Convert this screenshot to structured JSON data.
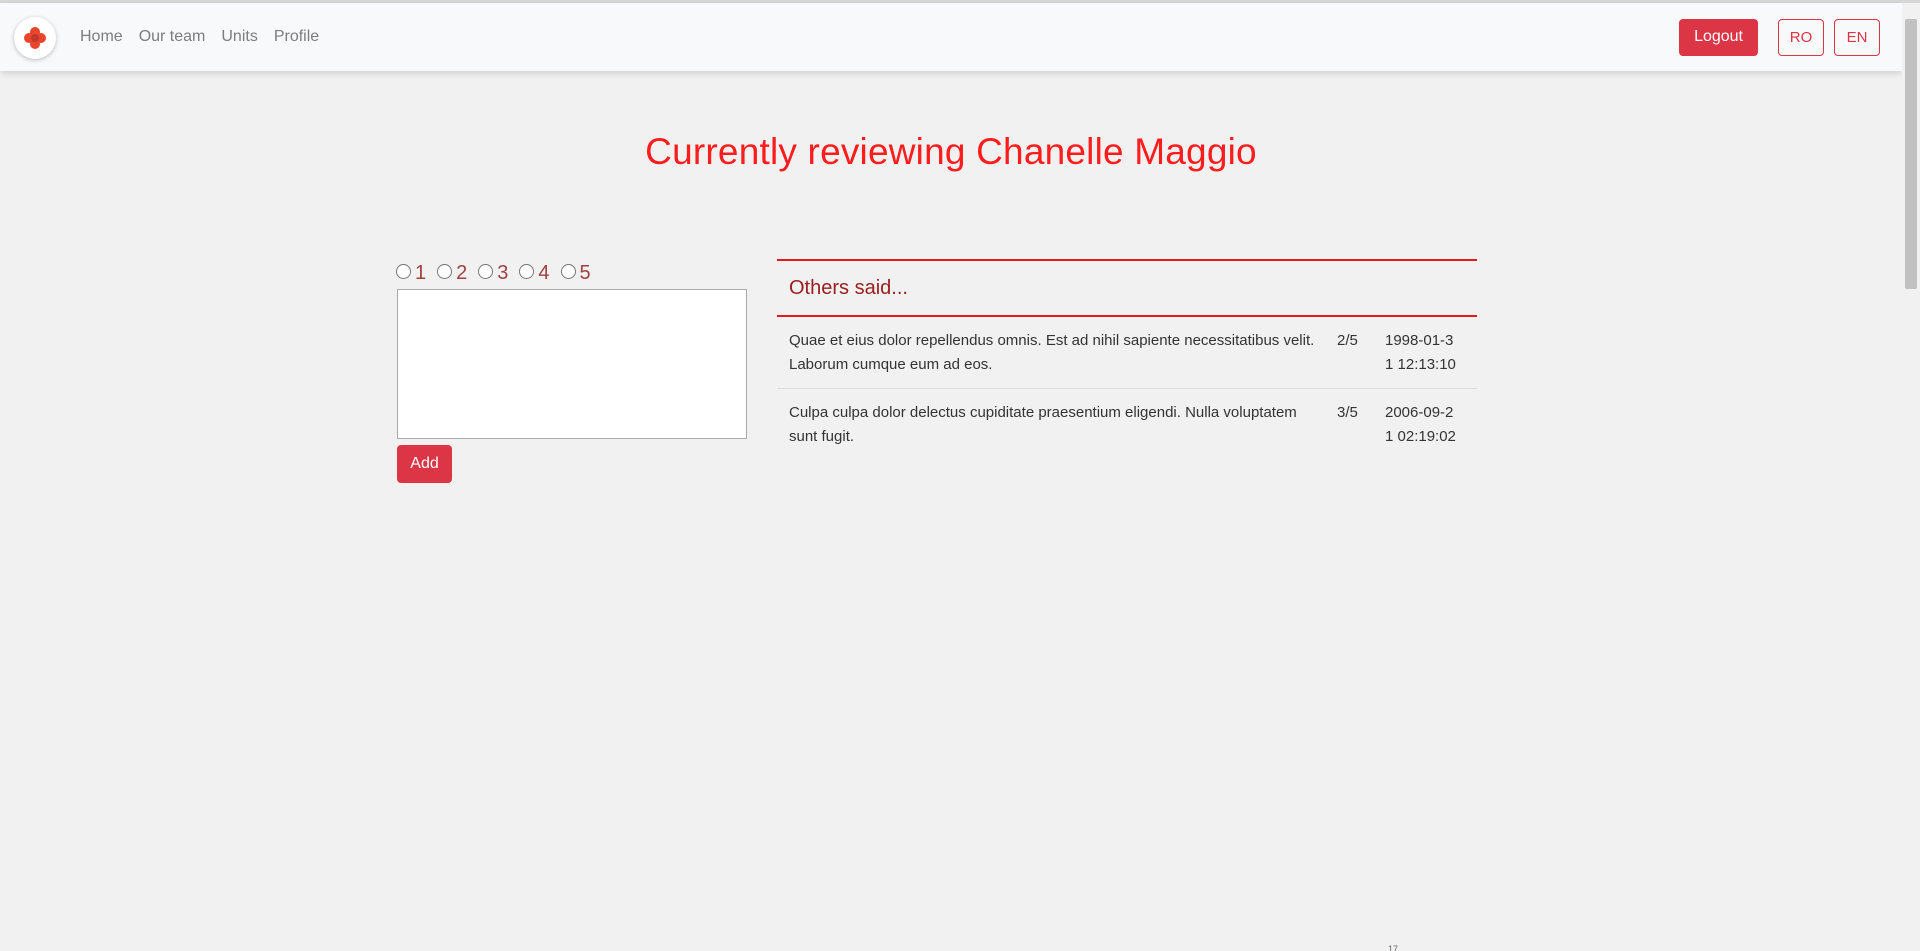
{
  "navbar": {
    "logo_icon": "medical-cross-icon",
    "links": [
      "Home",
      "Our team",
      "Units",
      "Profile"
    ],
    "logout_label": "Logout",
    "lang_ro": "RO",
    "lang_en": "EN"
  },
  "title": "Currently reviewing Chanelle Maggio",
  "review_form": {
    "ratings": [
      "1",
      "2",
      "3",
      "4",
      "5"
    ],
    "textarea_value": "",
    "add_label": "Add"
  },
  "others": {
    "heading": "Others said...",
    "rows": [
      {
        "text": "Quae et eius dolor repellendus omnis. Est ad nihil sapiente necessitatibus velit. Laborum cumque eum ad eos.",
        "score": "2/5",
        "date": "1998-01-31 12:13:10"
      },
      {
        "text": "Culpa culpa dolor delectus cupiditate praesentium eligendi. Nulla voluptatem sunt fugit.",
        "score": "3/5",
        "date": "2006-09-21 02:19:02"
      }
    ]
  },
  "footer_mark": "17",
  "colors": {
    "accent": "#dc3545",
    "title": "#ff1c1c",
    "background": "#f1f1f1"
  }
}
